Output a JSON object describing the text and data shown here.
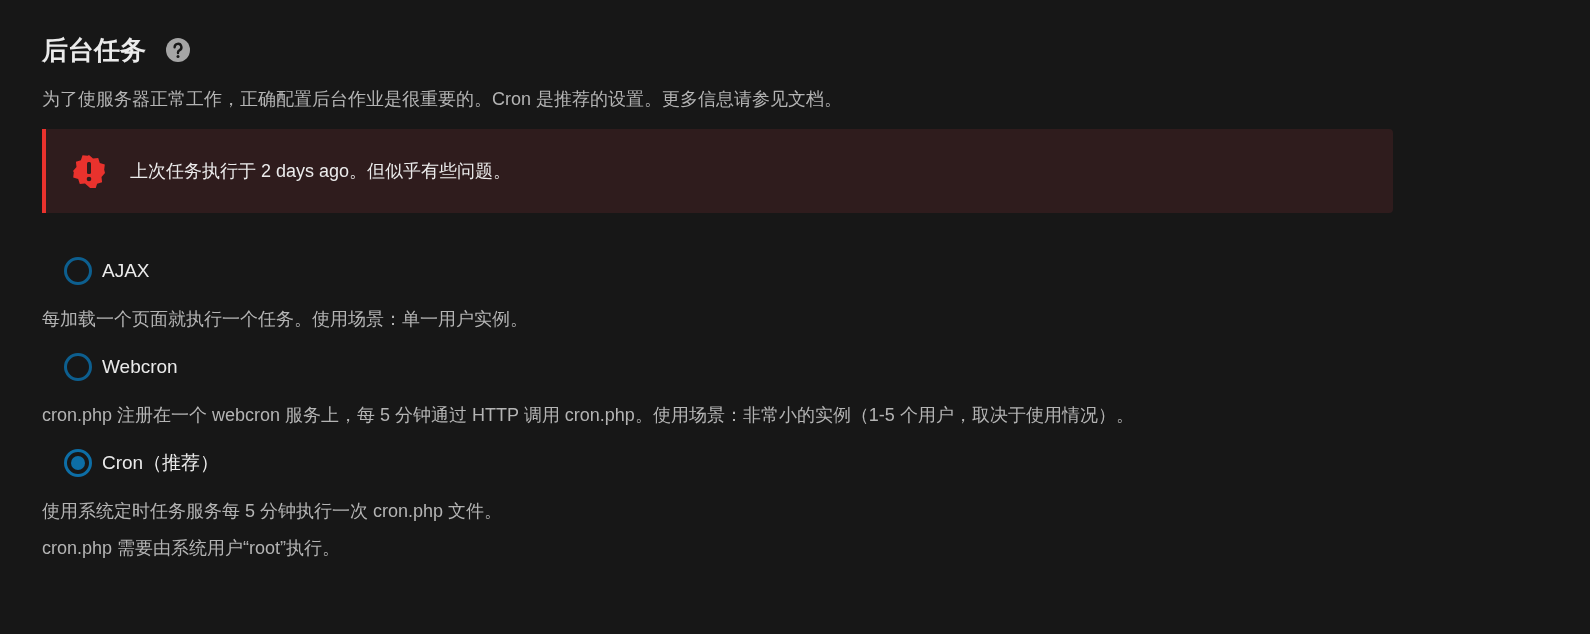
{
  "section": {
    "title": "后台任务",
    "description": "为了使服务器正常工作，正确配置后台作业是很重要的。Cron 是推荐的设置。更多信息请参见文档。"
  },
  "error_notice": {
    "text": "上次任务执行于 2 days ago。但似乎有些问题。"
  },
  "options": [
    {
      "label": "AJAX",
      "selected": false,
      "description": [
        "每加载一个页面就执行一个任务。使用场景：单一用户实例。"
      ]
    },
    {
      "label": "Webcron",
      "selected": false,
      "description": [
        "cron.php 注册在一个 webcron 服务上，每 5 分钟通过 HTTP 调用 cron.php。使用场景：非常小的实例（1-5 个用户，取决于使用情况）。"
      ]
    },
    {
      "label": "Cron（推荐）",
      "selected": true,
      "description": [
        "使用系统定时任务服务每 5 分钟执行一次 cron.php 文件。",
        "cron.php 需要由系统用户“root”执行。"
      ]
    }
  ]
}
